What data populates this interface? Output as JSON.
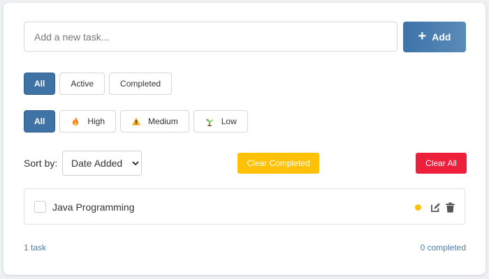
{
  "input": {
    "placeholder": "Add a new task...",
    "value": ""
  },
  "add_button": {
    "label": "Add",
    "icon": "plus-icon"
  },
  "status_filters": [
    {
      "label": "All",
      "active": true
    },
    {
      "label": "Active",
      "active": false
    },
    {
      "label": "Completed",
      "active": false
    }
  ],
  "priority_filters": [
    {
      "label": "All",
      "active": true
    },
    {
      "label": "High",
      "icon": "fire-icon",
      "active": false
    },
    {
      "label": "Medium",
      "icon": "warning-icon",
      "active": false
    },
    {
      "label": "Low",
      "icon": "seedling-icon",
      "active": false
    }
  ],
  "sort": {
    "label": "Sort by:",
    "selected": "Date Added"
  },
  "actions": {
    "clear_completed": "Clear Completed",
    "clear_all": "Clear All"
  },
  "tasks": [
    {
      "text": "Java Programming",
      "done": false,
      "priority": "medium",
      "priority_color": "#ffc107"
    }
  ],
  "footer": {
    "count": "1 task",
    "completed": "0 completed"
  },
  "colors": {
    "accent": "#3f72a5",
    "clear_completed": "#ffc107",
    "clear_all": "#ee1f3b",
    "footer_text": "#4a7eae"
  }
}
